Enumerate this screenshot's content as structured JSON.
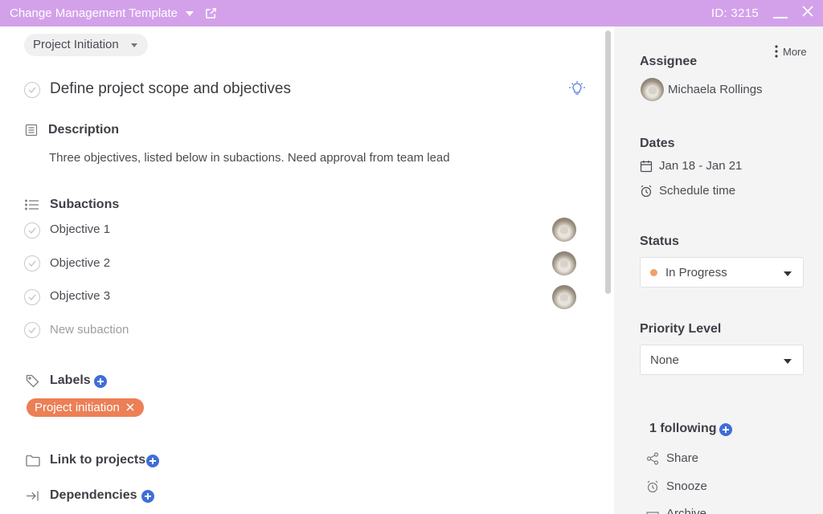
{
  "titlebar": {
    "template_name": "Change Management Template",
    "id_label": "ID: 3215",
    "bg_color": "#d3a1ea"
  },
  "task": {
    "project_pill": "Project Initiation",
    "title": "Define project scope and objectives"
  },
  "description": {
    "heading": "Description",
    "text": "Three objectives, listed below in subactions. Need approval from team lead"
  },
  "subactions": {
    "heading": "Subactions",
    "items": [
      {
        "label": "Objective 1"
      },
      {
        "label": "Objective 2"
      },
      {
        "label": "Objective 3"
      }
    ],
    "new_placeholder": "New subaction"
  },
  "labels": {
    "heading": "Labels",
    "chips": [
      {
        "label": "Project initiation",
        "color": "#ec7f56"
      }
    ]
  },
  "link_projects": {
    "heading": "Link to projects"
  },
  "dependencies": {
    "heading": "Dependencies"
  },
  "sidebar": {
    "more_label": "More",
    "assignee": {
      "heading": "Assignee",
      "name": "Michaela Rollings"
    },
    "dates": {
      "heading": "Dates",
      "range": "Jan 18 - Jan 21",
      "schedule": "Schedule time"
    },
    "status": {
      "heading": "Status",
      "value": "In Progress",
      "dot_color": "#f0a06e"
    },
    "priority": {
      "heading": "Priority Level",
      "value": "None"
    },
    "following": {
      "label": "1 following"
    },
    "actions": [
      {
        "label": "Share",
        "icon": "share-icon"
      },
      {
        "label": "Snooze",
        "icon": "alarm-icon"
      },
      {
        "label": "Archive",
        "icon": "archive-icon"
      }
    ]
  },
  "accent_color": "#3f6ed6"
}
